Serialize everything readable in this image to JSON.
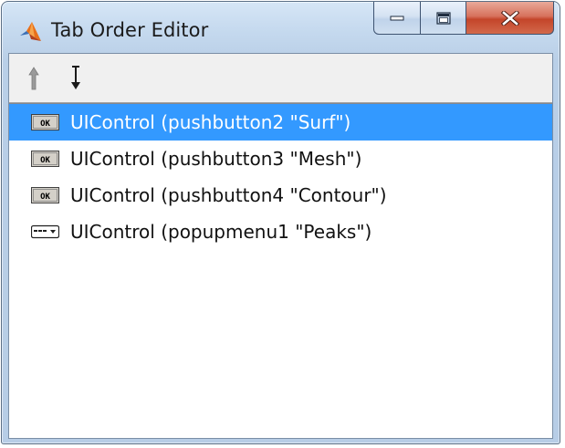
{
  "window": {
    "title": "Tab Order Editor"
  },
  "toolbar": {
    "move_up_icon": "arrow-up-icon",
    "move_down_icon": "arrow-down-icon"
  },
  "list": {
    "items": [
      {
        "label": "UIControl (pushbutton2 \"Surf\")",
        "icon": "pushbutton-ok-icon",
        "selected": true
      },
      {
        "label": "UIControl (pushbutton3 \"Mesh\")",
        "icon": "pushbutton-ok-icon",
        "selected": false
      },
      {
        "label": "UIControl (pushbutton4 \"Contour\")",
        "icon": "pushbutton-ok-icon",
        "selected": false
      },
      {
        "label": "UIControl (popupmenu1 \"Peaks\")",
        "icon": "popupmenu-icon",
        "selected": false
      }
    ]
  },
  "colors": {
    "selection": "#3399ff",
    "close_button": "#c4452a",
    "titlebar": "#c6daef"
  }
}
